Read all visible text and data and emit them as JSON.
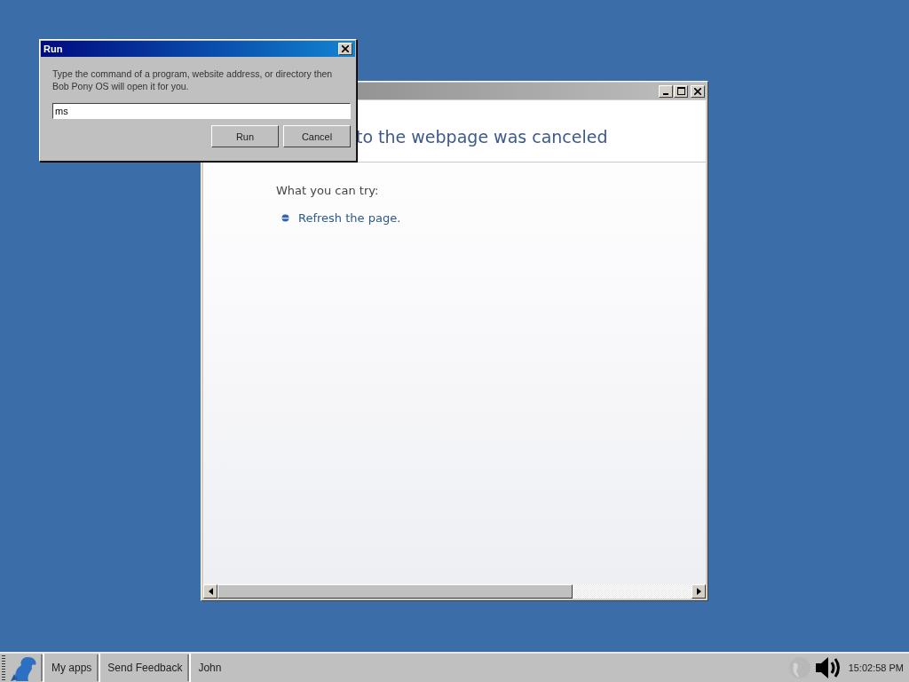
{
  "browser_window": {
    "heading": "to the webpage was canceled",
    "prompt": "What you can try:",
    "suggestions": [
      "Refresh the page."
    ]
  },
  "run_dialog": {
    "title": "Run",
    "message": "Type the command of a program, website address, or directory then Bob Pony OS will open it for you.",
    "input_value": "ms",
    "buttons": [
      "Run",
      "Cancel"
    ]
  },
  "taskbar": {
    "items": [
      "My apps",
      "Send Feedback",
      "John"
    ],
    "clock": "15:02:58 PM"
  }
}
